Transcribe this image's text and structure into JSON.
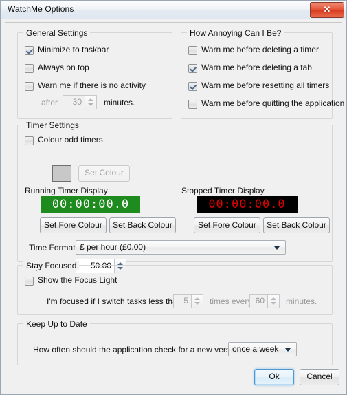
{
  "window": {
    "title": "WatchMe Options",
    "close_glyph": "✕"
  },
  "general_settings": {
    "legend": "General Settings",
    "items": [
      {
        "label": "Minimize to taskbar",
        "checked": true
      },
      {
        "label": "Always on top",
        "checked": false
      },
      {
        "label": "Warn me if there is no activity",
        "checked": false
      }
    ],
    "after_label": "after",
    "inactivity_minutes": "30",
    "minutes_label": "minutes."
  },
  "annoying": {
    "legend": "How Annoying Can I Be?",
    "items": [
      {
        "label": "Warn me before deleting a timer",
        "checked": false
      },
      {
        "label": "Warn me before deleting a tab",
        "checked": true
      },
      {
        "label": "Warn me before resetting all timers",
        "checked": true
      },
      {
        "label": "Warn me before quitting the application",
        "checked": false
      }
    ]
  },
  "timer_settings": {
    "legend": "Timer Settings",
    "colour_odd_label": "Colour odd timers",
    "colour_odd_checked": false,
    "set_colour_button": "Set Colour",
    "swatch_colour": "#c8c8c8",
    "running": {
      "label": "Running Timer Display",
      "value": "00:00:00.0",
      "fore_colour": "#ffffff",
      "back_colour": "#1e8b1e",
      "fore_button": "Set Fore Colour",
      "back_button": "Set Back Colour"
    },
    "stopped": {
      "label": "Stopped Timer Display",
      "value": "00:00:00.0",
      "fore_colour": "#e00000",
      "back_colour": "#000000",
      "fore_button": "Set Fore Colour",
      "back_button": "Set Back Colour"
    },
    "time_format_label": "Time Format",
    "time_format_value": "£ per hour (£0.00)",
    "rate_label": "£ per hour",
    "rate_value": "50.00"
  },
  "stay_focused": {
    "legend": "Stay Focused",
    "focus_light_label": "Show the Focus Light",
    "focus_light_checked": false,
    "sentence_start": "I'm focused if I switch tasks less than",
    "switch_count": "5",
    "sentence_middle": "times every",
    "period_minutes": "60",
    "sentence_end": "minutes."
  },
  "keep_up_to_date": {
    "legend": "Keep Up to Date",
    "question": "How often should the application check for a new version?",
    "frequency_value": "once a week"
  },
  "footer": {
    "ok_label": "Ok",
    "cancel_label": "Cancel"
  }
}
